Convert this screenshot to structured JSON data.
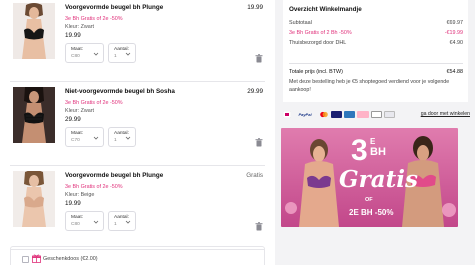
{
  "cart": {
    "items": [
      {
        "name": "Voorgevormde beugel bh Plunge",
        "price": "19.99",
        "promo": "3e Bh Gratis of 2e -50%",
        "color": "Kleur: Zwart",
        "unit_price": "19.99",
        "size_label": "Maat:",
        "size_value": "C80",
        "qty_label": "Aantal:",
        "qty_value": "1"
      },
      {
        "name": "Niet-voorgevormde beugel bh Sosha",
        "price": "29.99",
        "promo": "3e Bh Gratis of 2e -50%",
        "color": "Kleur: Zwart",
        "unit_price": "29.99",
        "size_label": "Maat:",
        "size_value": "C70",
        "qty_label": "Aantal:",
        "qty_value": "1"
      },
      {
        "name": "Voorgevormde beugel bh Plunge",
        "price": "Gratis",
        "promo": "3e Bh Gratis of 2e -50%",
        "color": "Kleur: Beige",
        "unit_price": "19.99",
        "size_label": "Maat:",
        "size_value": "C80",
        "qty_label": "Aantal:",
        "qty_value": "1"
      }
    ],
    "gift_box_label": "Geschenkdoos (€2.00)"
  },
  "summary": {
    "title": "Overzicht Winkelmandje",
    "rows": [
      {
        "label": "Subtotaal",
        "value": "€69.97"
      },
      {
        "label": "3e Bh Gratis of 2 Bh -50%",
        "value": "-€19.99"
      },
      {
        "label": "Thuisbezorgd door DHL",
        "value": "€4.90"
      }
    ],
    "total_label": "Totale prijs (incl. BTW)",
    "total_value": "€54.88",
    "note": "Met deze bestelling heb je €5 shoptegoed verdiend voor je volgende aankoop!"
  },
  "payments": {
    "icons": [
      "ideal-icon",
      "paypal-icon",
      "mastercard-icon",
      "visa-icon",
      "amex-icon",
      "klarna-icon",
      "applepay-icon",
      "bancontact-icon"
    ],
    "paypal_text": "PayPal",
    "link_label": "ga door met winkelen"
  },
  "banner": {
    "big_number": "3",
    "ordinal": "E",
    "bh": "BH",
    "gratis": "Gratis",
    "of": "OF",
    "second_line": "2E BH -50%"
  },
  "colors": {
    "promo_pink": "#e0307a",
    "summary_bg": "#f3f3f5",
    "banner_bg": "#d75e9e"
  }
}
